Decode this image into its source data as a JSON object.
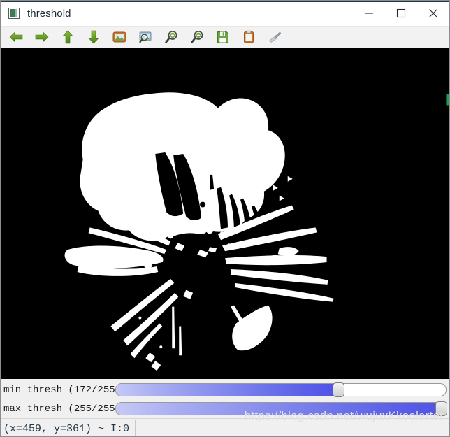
{
  "window": {
    "title": "threshold",
    "icon": "threshold-window-icon",
    "controls": [
      {
        "name": "minimize-button",
        "glyph": "minimize-icon"
      },
      {
        "name": "maximize-button",
        "glyph": "maximize-icon"
      },
      {
        "name": "close-button",
        "glyph": "close-icon"
      }
    ]
  },
  "toolbar": {
    "items": [
      {
        "name": "back-button",
        "icon": "arrow-left-icon",
        "color": "#5a9216"
      },
      {
        "name": "forward-button",
        "icon": "arrow-right-icon",
        "color": "#5a9216"
      },
      {
        "name": "pan-up-button",
        "icon": "arrow-up-icon",
        "color": "#5a9216"
      },
      {
        "name": "pan-down-button",
        "icon": "arrow-down-icon",
        "color": "#5a9216"
      },
      {
        "name": "fit-image-button",
        "icon": "picture-icon",
        "color": "#c0702a"
      },
      {
        "name": "zoom-region-button",
        "icon": "picture-magnifier-icon",
        "color": "#7a9fbf"
      },
      {
        "name": "zoom-in-button",
        "icon": "magnifier-plus-icon",
        "color": "#5a9216"
      },
      {
        "name": "zoom-out-button",
        "icon": "magnifier-minus-icon",
        "color": "#5a9216"
      },
      {
        "name": "save-image-button",
        "icon": "floppy-save-icon",
        "color": "#5a9216"
      },
      {
        "name": "copy-clipboard-button",
        "icon": "clipboard-icon",
        "color": "#c0702a"
      },
      {
        "name": "clear-button",
        "icon": "brush-icon",
        "color": "#9aa3ab"
      }
    ]
  },
  "image": {
    "name": "threshold-binary-image",
    "background": "#000000",
    "foreground": "#ffffff",
    "description": "binary thresholded flower"
  },
  "trackbars": [
    {
      "name": "min-thresh",
      "label": "min thresh (172/255)",
      "value": 172,
      "max": 255,
      "percent": 67.5
    },
    {
      "name": "max-thresh",
      "label": "max thresh (255/255)",
      "value": 255,
      "max": 255,
      "percent": 100
    }
  ],
  "status": {
    "coordinates": "(x=459, y=361) ~ I:0",
    "watermark": "https://blog.csdn.net/wujuxKkoolerter"
  },
  "colors": {
    "slider_fill_start": "#c6c9f6",
    "slider_fill_end": "#4f52e6",
    "title_bar": "#ffffff",
    "panel": "#f0f0f0",
    "accent_green": "#5a9216"
  }
}
